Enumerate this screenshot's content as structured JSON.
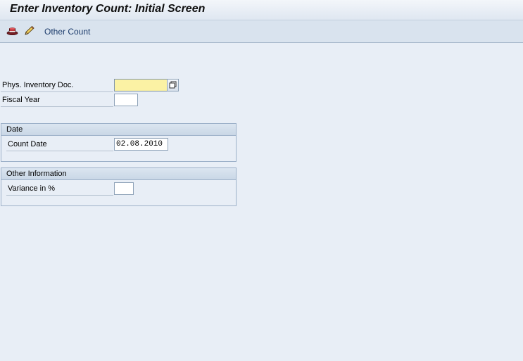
{
  "window": {
    "title": "Enter Inventory Count: Initial Screen"
  },
  "toolbar": {
    "icons": [
      "hat-icon",
      "pencil-icon"
    ],
    "other_count_label": "Other Count"
  },
  "fields": {
    "phys_inventory_doc": {
      "label": "Phys. Inventory Doc.",
      "value": "",
      "required": true
    },
    "fiscal_year": {
      "label": "Fiscal Year",
      "value": ""
    }
  },
  "groups": {
    "date": {
      "title": "Date",
      "count_date_label": "Count Date",
      "count_date_value": "02.08.2010"
    },
    "other_information": {
      "title": "Other Information",
      "variance_label": "Variance in %",
      "variance_value": ""
    }
  },
  "colors": {
    "required_field_bg": "#fbf2a4",
    "background": "#e8eef6",
    "toolbar_link": "#1b3b6b"
  }
}
